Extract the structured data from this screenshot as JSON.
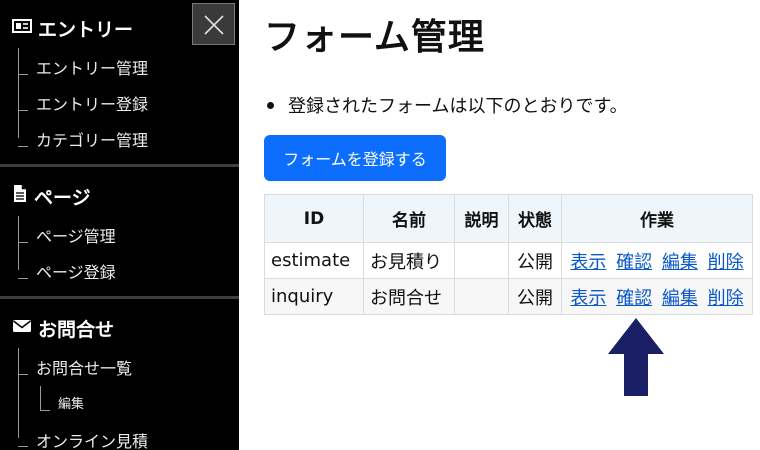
{
  "sidebar": {
    "sections": [
      {
        "label": "エントリー",
        "icon": "newspaper-icon",
        "items": [
          "エントリー管理",
          "エントリー登録",
          "カテゴリー管理"
        ]
      },
      {
        "label": "ページ",
        "icon": "document-icon",
        "items": [
          "ページ管理",
          "ページ登録"
        ]
      },
      {
        "label": "お問合せ",
        "icon": "envelope-icon",
        "items": [
          "お問合せ一覧",
          "編集",
          "オンライン見積"
        ]
      }
    ]
  },
  "main": {
    "title": "フォーム管理",
    "description": "登録されたフォームは以下のとおりです。",
    "register_button": "フォームを登録する",
    "table": {
      "headers": [
        "ID",
        "名前",
        "説明",
        "状態",
        "作業"
      ],
      "rows": [
        {
          "id": "estimate",
          "name": "お見積り",
          "description": "",
          "status": "公開",
          "actions": [
            "表示",
            "確認",
            "編集",
            "削除"
          ]
        },
        {
          "id": "inquiry",
          "name": "お問合せ",
          "description": "",
          "status": "公開",
          "actions": [
            "表示",
            "確認",
            "編集",
            "削除"
          ]
        }
      ]
    }
  },
  "colors": {
    "sidebar_bg": "#000000",
    "primary_button": "#0d6efd",
    "link": "#0a58ca",
    "arrow": "#1b1f66"
  }
}
